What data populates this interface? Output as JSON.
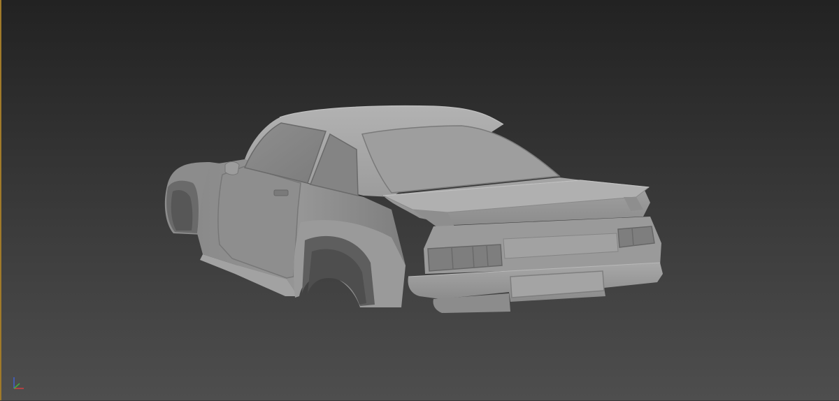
{
  "viewport": {
    "name": "perspective-viewport",
    "background_top": "#222222",
    "background_bottom": "#4e4e4e",
    "border_color": "#a07a2a"
  },
  "model": {
    "shading": "clay",
    "base_color": "#9a9a9a",
    "shadow_color": "#6e6e6e",
    "highlight_color": "#b4b4b4"
  },
  "gizmo": {
    "axis_x_color": "#d04040",
    "axis_y_color": "#40b040",
    "axis_z_color": "#4060d0"
  }
}
